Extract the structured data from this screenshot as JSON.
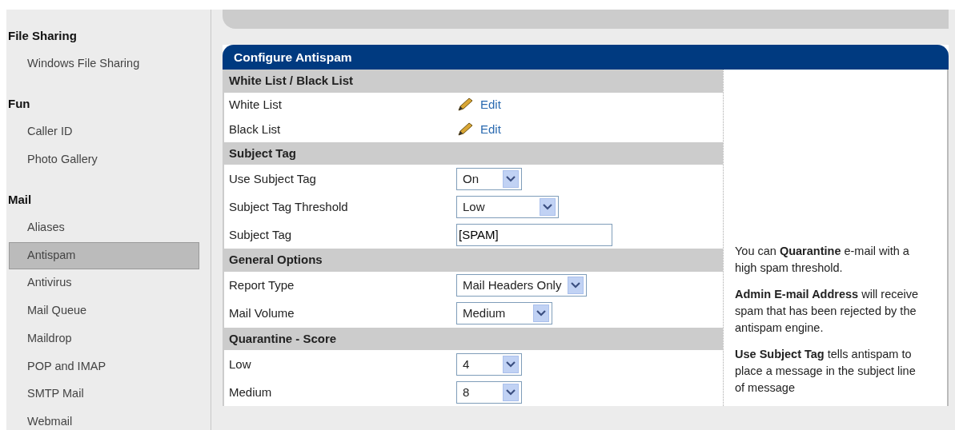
{
  "sidebar": {
    "groups": [
      {
        "heading": "File Sharing",
        "items": [
          {
            "label": "Windows File Sharing",
            "selected": false
          }
        ]
      },
      {
        "heading": "Fun",
        "items": [
          {
            "label": "Caller ID",
            "selected": false
          },
          {
            "label": "Photo Gallery",
            "selected": false
          }
        ]
      },
      {
        "heading": "Mail",
        "items": [
          {
            "label": "Aliases",
            "selected": false
          },
          {
            "label": "Antispam",
            "selected": true
          },
          {
            "label": "Antivirus",
            "selected": false
          },
          {
            "label": "Mail Queue",
            "selected": false
          },
          {
            "label": "Maildrop",
            "selected": false
          },
          {
            "label": "POP and IMAP",
            "selected": false
          },
          {
            "label": "SMTP Mail",
            "selected": false
          },
          {
            "label": "Webmail",
            "selected": false
          }
        ]
      }
    ]
  },
  "panel": {
    "title": "Configure Antispam",
    "sections": [
      {
        "heading": "White List / Black List",
        "rows": [
          {
            "kind": "link",
            "label": "White List",
            "value": "Edit"
          },
          {
            "kind": "link",
            "label": "Black List",
            "value": "Edit"
          }
        ]
      },
      {
        "heading": "Subject Tag",
        "rows": [
          {
            "kind": "select",
            "label": "Use Subject Tag",
            "value": "On"
          },
          {
            "kind": "select",
            "label": "Subject Tag Threshold",
            "value": "Low"
          },
          {
            "kind": "text",
            "label": "Subject Tag",
            "value": "[SPAM]"
          }
        ]
      },
      {
        "heading": "General Options",
        "rows": [
          {
            "kind": "select",
            "label": "Report Type",
            "value": "Mail Headers Only"
          },
          {
            "kind": "select",
            "label": "Mail Volume",
            "value": "Medium"
          }
        ]
      },
      {
        "heading": "Quarantine - Score",
        "rows": [
          {
            "kind": "select",
            "label": "Low",
            "value": "4"
          },
          {
            "kind": "select",
            "label": "Medium",
            "value": "8"
          }
        ]
      }
    ],
    "help": [
      "You can **Quarantine** e-mail with a high spam threshold.",
      "**Admin E-mail Address** will receive spam that has been rejected by the antispam engine.",
      "**Use Subject Tag** tells antispam to place a message in the subject line of message"
    ]
  }
}
